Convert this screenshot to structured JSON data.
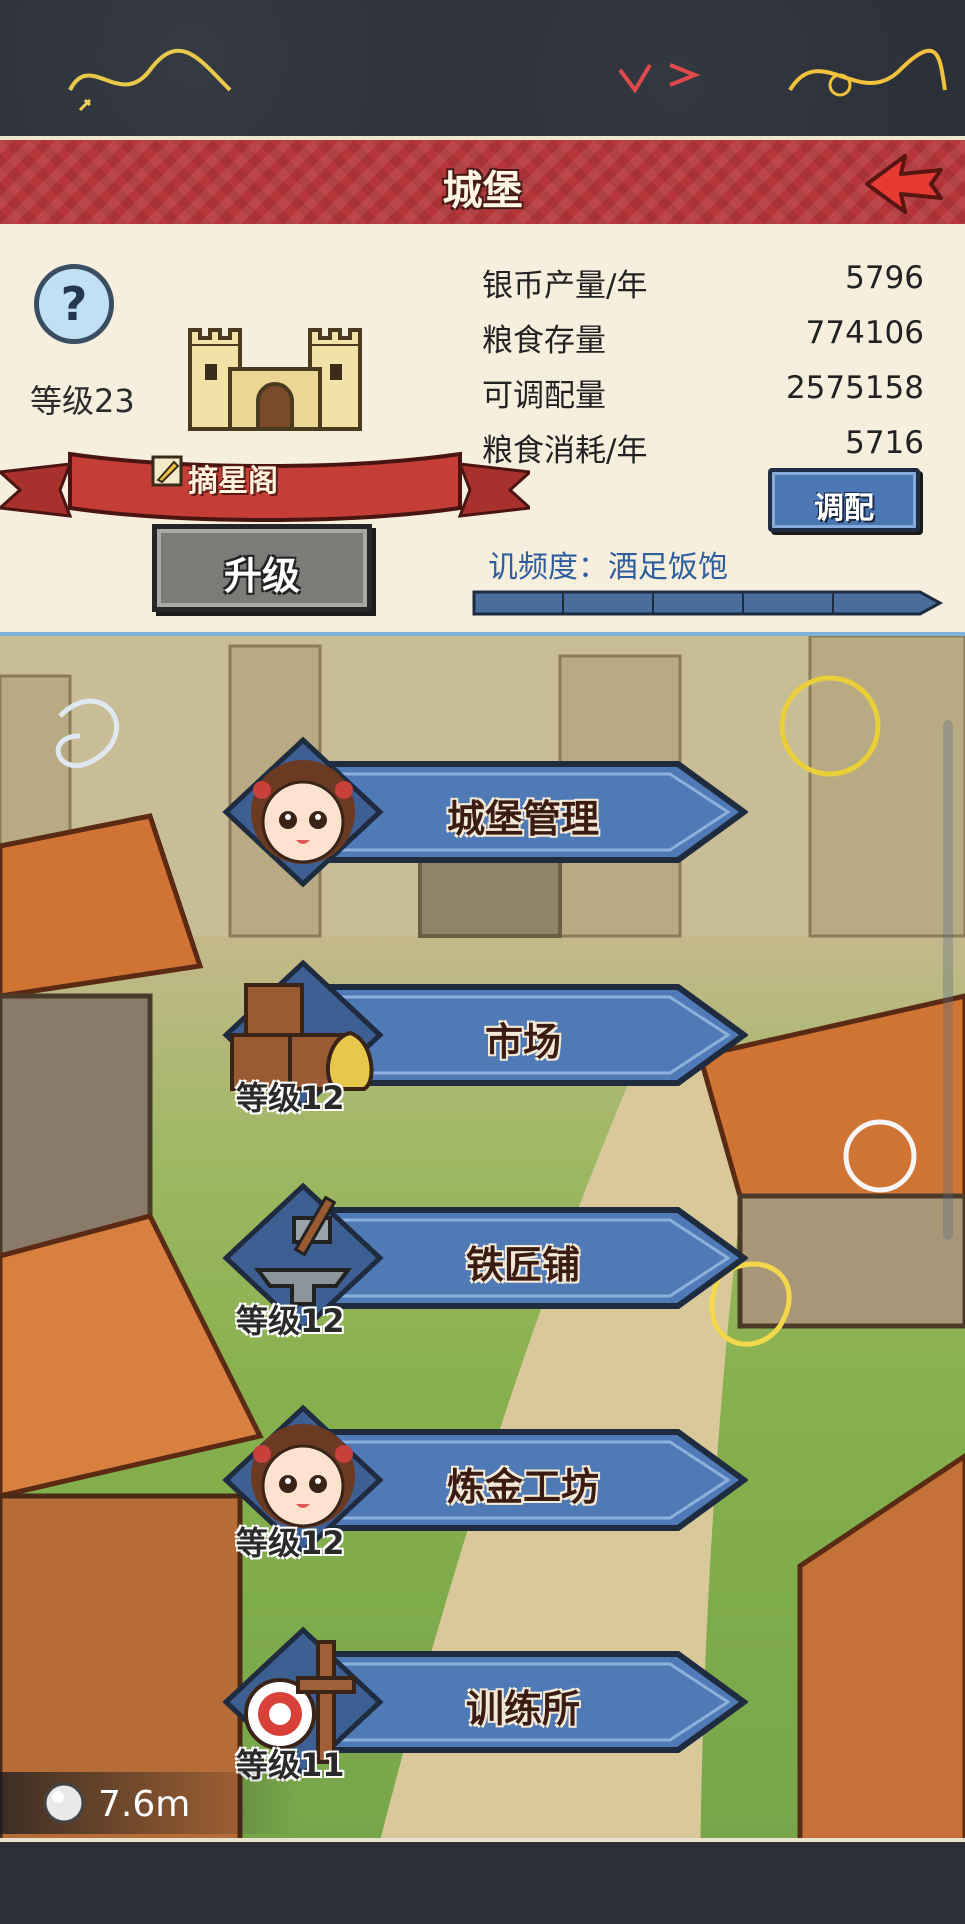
{
  "header": {
    "title": "城堡"
  },
  "castle": {
    "level": "等级23",
    "ribbon": "摘星阁",
    "upgrade": "升级"
  },
  "stats": [
    {
      "label": "银币产量/年",
      "value": "5796"
    },
    {
      "label": "粮食存量",
      "value": "774106"
    },
    {
      "label": "可调配量",
      "value": "2575158"
    },
    {
      "label": "粮食消耗/年",
      "value": "5716"
    }
  ],
  "allocate": "调配",
  "satiety": "讥频度：酒足饭饱",
  "menu": [
    {
      "label": "城堡管理",
      "level": ""
    },
    {
      "label": "市场",
      "level": "等级12"
    },
    {
      "label": "铁匠铺",
      "level": "等级12"
    },
    {
      "label": "炼金工坊",
      "level": "等级12"
    },
    {
      "label": "训练所",
      "level": "等级11"
    }
  ],
  "silver": "7.6m",
  "colors": {
    "header_red": "#b7363a",
    "button_blue": "#4b77b5",
    "panel_cream": "#f6efde"
  }
}
